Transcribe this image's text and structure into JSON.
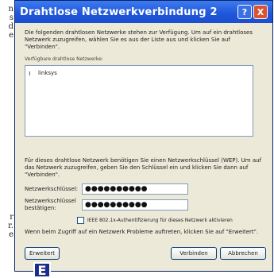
{
  "doc_fragments": [
    "n",
    "s",
    "d",
    "e",
    "",
    "",
    "",
    "",
    "",
    "",
    "",
    "",
    "",
    "",
    "",
    "",
    "",
    "",
    "",
    "",
    "",
    "",
    "",
    "r",
    "r.",
    "e"
  ],
  "window": {
    "title": "Drahtlose Netzwerkverbindung 2",
    "help": "?",
    "close": "X"
  },
  "intro_text": "Die folgenden drahtlosen Netzwerke stehen zur Verfügung. Um auf ein drahtloses Netzwerk zuzugreifen, wählen Sie es aus der Liste aus und klicken Sie auf \"Verbinden\".",
  "networks_label": "Verfügbare drahtlose Netzwerke:",
  "networks": [
    {
      "name": "linksys"
    }
  ],
  "wep_text": "Für dieses drahtlose Netzwerk benötigen Sie einen Netzwerkschlüssel (WEP). Um auf das Netzwerk zuzugreifen, geben Sie den Schlüssel ein und klicken Sie dann auf \"Verbinden\".",
  "fields": {
    "key_label": "Netzwerkschlüssel:",
    "key_value": "●●●●●●●●●●",
    "confirm_label": "Netzwerkschlüssel bestätigen:",
    "confirm_value": "●●●●●●●●●●"
  },
  "checkbox_label": "IEEE 802.1x-Authentifizierung für dieses Netzwerk aktivieren",
  "trouble_text": "Wenn beim Zugriff auf ein Netzwerk Probleme auftreten, klicken Sie auf \"Erweitert\".",
  "buttons": {
    "advanced": "Erweitert",
    "connect": "Verbinden",
    "cancel": "Abbrechen"
  },
  "badge": "E",
  "colors": {
    "titlebar": "#1f55d8",
    "dialog_bg": "#ece9d8",
    "badge_bg": "#1c2c8c"
  }
}
